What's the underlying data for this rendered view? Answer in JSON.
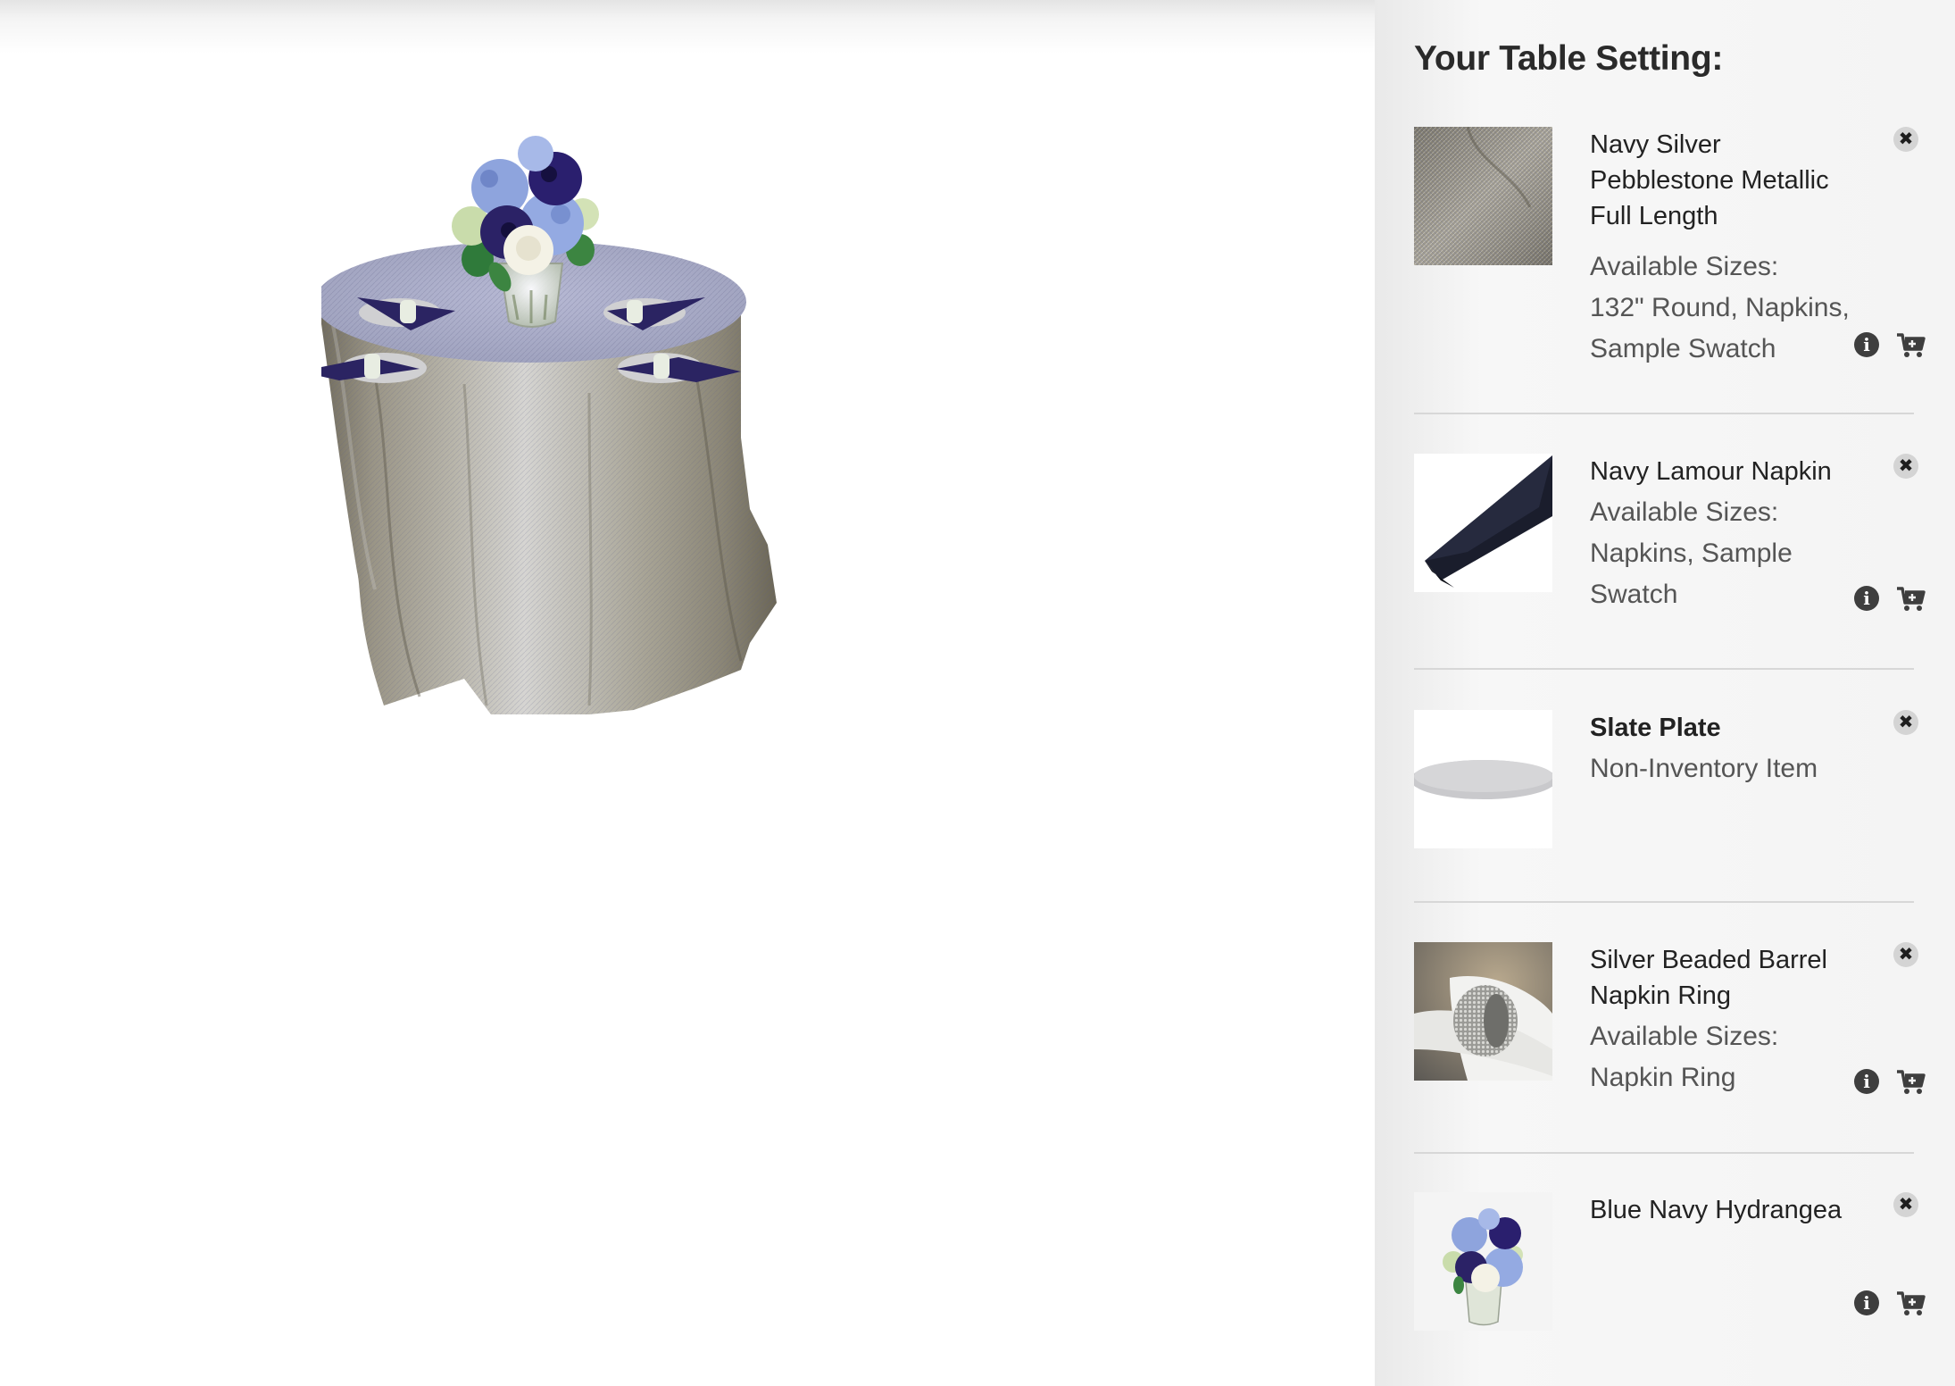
{
  "sidebar": {
    "title": "Your Table Setting:",
    "items": [
      {
        "name": "Navy Silver Pebblestone Metallic Full Length",
        "sizes_label": "Available Sizes:",
        "sizes": "132\" Round, Napkins, Sample Swatch",
        "thumb_icon": "fabric-swatch-icon",
        "has_actions": true
      },
      {
        "name": "Navy Lamour Napkin",
        "sizes_label": "Available Sizes:",
        "sizes": "Napkins, Sample Swatch",
        "thumb_icon": "napkin-icon",
        "has_actions": true
      },
      {
        "name": "Slate Plate",
        "note": "Non-Inventory Item",
        "thumb_icon": "plate-icon",
        "has_actions": false
      },
      {
        "name": "Silver Beaded Barrel Napkin Ring",
        "sizes_label": "Available Sizes:",
        "sizes": "Napkin Ring",
        "thumb_icon": "napkin-ring-icon",
        "has_actions": true
      },
      {
        "name": "Blue Navy Hydrangea",
        "thumb_icon": "flower-centerpiece-icon",
        "has_actions": true
      }
    ],
    "icons": {
      "remove": "close-icon",
      "info": "info-icon",
      "cart": "add-to-cart-icon"
    },
    "glyphs": {
      "remove": "✖",
      "info": "i"
    }
  },
  "colors": {
    "sidebar_bg": "#f4f4f4",
    "linen_base": "#8f8a7c",
    "linen_highlight": "#c9c6bc",
    "navy": "#2b2462",
    "hydrangea_blue": "#8ea4dd",
    "plate": "#d0d0d2"
  }
}
